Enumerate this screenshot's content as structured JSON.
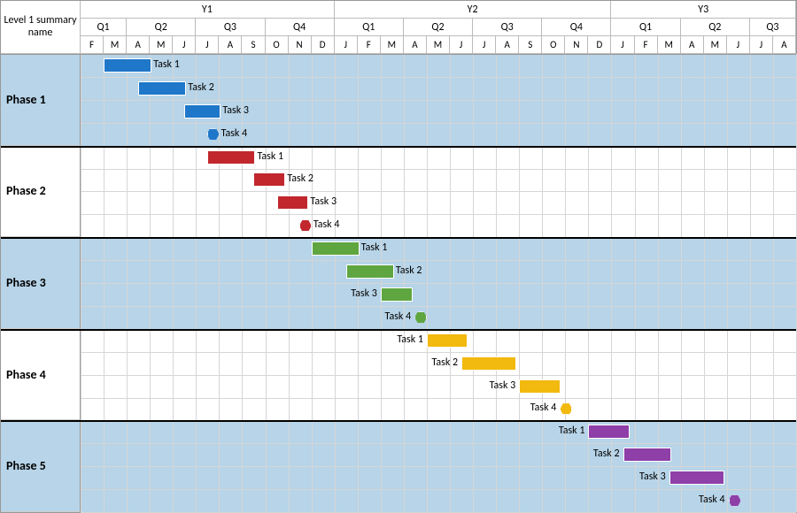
{
  "header": {
    "title": "Level 1 summary name"
  },
  "years": [
    "Y1",
    "Y2",
    "Y3"
  ],
  "quarters": [
    "Q1",
    "Q2",
    "Q3",
    "Q4",
    "Q1",
    "Q2",
    "Q3",
    "Q4",
    "Q1",
    "Q2",
    "Q3"
  ],
  "months": [
    "F",
    "M",
    "A",
    "M",
    "J",
    "J",
    "A",
    "S",
    "O",
    "N",
    "D",
    "J",
    "F",
    "M",
    "A",
    "M",
    "J",
    "J",
    "A",
    "S",
    "O",
    "N",
    "D",
    "J",
    "F",
    "M",
    "A",
    "M",
    "J",
    "J",
    "A"
  ],
  "phases": [
    {
      "name": "Phase 1",
      "color": "#1F77C9",
      "shade": true,
      "tasks": [
        {
          "label": "Task 1",
          "start": 1,
          "dur": 2,
          "labelSide": "right"
        },
        {
          "label": "Task 2",
          "start": 2.5,
          "dur": 2,
          "labelSide": "right"
        },
        {
          "label": "Task 3",
          "start": 4.5,
          "dur": 1.5,
          "labelSide": "right"
        },
        {
          "label": "Task 4",
          "start": 5.7,
          "dur": 0,
          "labelSide": "right"
        }
      ]
    },
    {
      "name": "Phase 2",
      "color": "#C1272D",
      "shade": false,
      "tasks": [
        {
          "label": "Task 1",
          "start": 5.5,
          "dur": 2,
          "labelSide": "right"
        },
        {
          "label": "Task 2",
          "start": 7.5,
          "dur": 1.3,
          "labelSide": "right"
        },
        {
          "label": "Task 3",
          "start": 8.5,
          "dur": 1.3,
          "labelSide": "right"
        },
        {
          "label": "Task 4",
          "start": 9.7,
          "dur": 0,
          "labelSide": "right"
        }
      ]
    },
    {
      "name": "Phase 3",
      "color": "#5FA641",
      "shade": true,
      "tasks": [
        {
          "label": "Task 1",
          "start": 10,
          "dur": 2,
          "labelSide": "right"
        },
        {
          "label": "Task 2",
          "start": 11.5,
          "dur": 2,
          "labelSide": "right"
        },
        {
          "label": "Task 3",
          "start": 13,
          "dur": 1.3,
          "labelSide": "left"
        },
        {
          "label": "Task 4",
          "start": 14.7,
          "dur": 0,
          "labelSide": "left"
        }
      ]
    },
    {
      "name": "Phase 4",
      "color": "#F2B90F",
      "shade": false,
      "tasks": [
        {
          "label": "Task 1",
          "start": 15,
          "dur": 1.7,
          "labelSide": "left"
        },
        {
          "label": "Task 2",
          "start": 16.5,
          "dur": 2.3,
          "labelSide": "left"
        },
        {
          "label": "Task 3",
          "start": 19,
          "dur": 1.7,
          "labelSide": "left"
        },
        {
          "label": "Task 4",
          "start": 21,
          "dur": 0,
          "labelSide": "left"
        }
      ]
    },
    {
      "name": "Phase 5",
      "color": "#8E3FA8",
      "shade": true,
      "tasks": [
        {
          "label": "Task 1",
          "start": 22,
          "dur": 1.7,
          "labelSide": "left"
        },
        {
          "label": "Task 2",
          "start": 23.5,
          "dur": 2,
          "labelSide": "left"
        },
        {
          "label": "Task 3",
          "start": 25.5,
          "dur": 2.3,
          "labelSide": "left"
        },
        {
          "label": "Task 4",
          "start": 28.3,
          "dur": 0,
          "labelSide": "left"
        }
      ]
    }
  ],
  "chart_data": {
    "type": "gantt",
    "title": "Level 1 summary name",
    "time_axis": {
      "unit": "month",
      "start": "Y1-Feb",
      "months": 31,
      "year_spans": [
        {
          "label": "Y1",
          "months": 11
        },
        {
          "label": "Y2",
          "months": 12
        },
        {
          "label": "Y3",
          "months": 8
        }
      ],
      "quarter_spans": [
        2,
        3,
        3,
        3,
        3,
        3,
        3,
        3,
        3,
        3,
        2
      ]
    },
    "series": [
      {
        "name": "Phase 1",
        "color": "#1F77C9",
        "tasks": [
          {
            "name": "Task 1",
            "start_month": 1,
            "duration_months": 2,
            "milestone": false
          },
          {
            "name": "Task 2",
            "start_month": 2.5,
            "duration_months": 2,
            "milestone": false
          },
          {
            "name": "Task 3",
            "start_month": 4.5,
            "duration_months": 1.5,
            "milestone": false
          },
          {
            "name": "Task 4",
            "start_month": 5.7,
            "duration_months": 0,
            "milestone": true
          }
        ]
      },
      {
        "name": "Phase 2",
        "color": "#C1272D",
        "tasks": [
          {
            "name": "Task 1",
            "start_month": 5.5,
            "duration_months": 2,
            "milestone": false
          },
          {
            "name": "Task 2",
            "start_month": 7.5,
            "duration_months": 1.3,
            "milestone": false
          },
          {
            "name": "Task 3",
            "start_month": 8.5,
            "duration_months": 1.3,
            "milestone": false
          },
          {
            "name": "Task 4",
            "start_month": 9.7,
            "duration_months": 0,
            "milestone": true
          }
        ]
      },
      {
        "name": "Phase 3",
        "color": "#5FA641",
        "tasks": [
          {
            "name": "Task 1",
            "start_month": 10,
            "duration_months": 2,
            "milestone": false
          },
          {
            "name": "Task 2",
            "start_month": 11.5,
            "duration_months": 2,
            "milestone": false
          },
          {
            "name": "Task 3",
            "start_month": 13,
            "duration_months": 1.3,
            "milestone": false
          },
          {
            "name": "Task 4",
            "start_month": 14.7,
            "duration_months": 0,
            "milestone": true
          }
        ]
      },
      {
        "name": "Phase 4",
        "color": "#F2B90F",
        "tasks": [
          {
            "name": "Task 1",
            "start_month": 15,
            "duration_months": 1.7,
            "milestone": false
          },
          {
            "name": "Task 2",
            "start_month": 16.5,
            "duration_months": 2.3,
            "milestone": false
          },
          {
            "name": "Task 3",
            "start_month": 19,
            "duration_months": 1.7,
            "milestone": false
          },
          {
            "name": "Task 4",
            "start_month": 21,
            "duration_months": 0,
            "milestone": true
          }
        ]
      },
      {
        "name": "Phase 5",
        "color": "#8E3FA8",
        "tasks": [
          {
            "name": "Task 1",
            "start_month": 22,
            "duration_months": 1.7,
            "milestone": false
          },
          {
            "name": "Task 2",
            "start_month": 23.5,
            "duration_months": 2,
            "milestone": false
          },
          {
            "name": "Task 3",
            "start_month": 25.5,
            "duration_months": 2.3,
            "milestone": false
          },
          {
            "name": "Task 4",
            "start_month": 28.3,
            "duration_months": 0,
            "milestone": true
          }
        ]
      }
    ]
  }
}
